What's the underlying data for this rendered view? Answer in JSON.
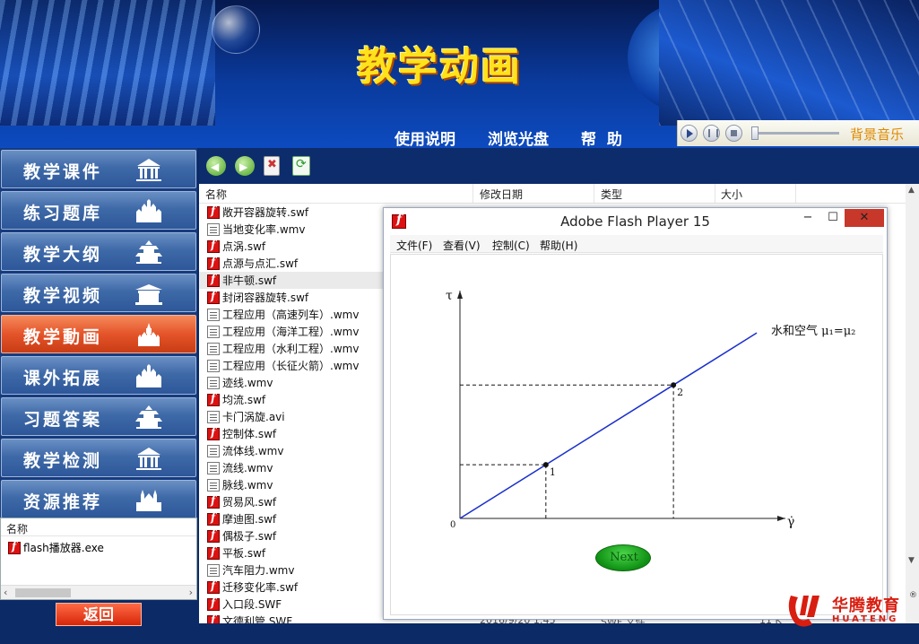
{
  "banner": {
    "title": "教学动画",
    "nav": [
      "使用说明",
      "浏览光盘",
      "帮  助"
    ]
  },
  "music": {
    "label": "背景音乐",
    "controls": [
      "play-icon",
      "pause-icon",
      "stop-icon"
    ]
  },
  "sidebar": {
    "items": [
      {
        "label": "教学课件",
        "icon": "building-icon"
      },
      {
        "label": "练习题库",
        "icon": "castle-icon"
      },
      {
        "label": "教学大纲",
        "icon": "temple-icon"
      },
      {
        "label": "教学视频",
        "icon": "gate-icon"
      },
      {
        "label": "教学動画",
        "icon": "kremlin-icon",
        "active": true
      },
      {
        "label": "课外拓展",
        "icon": "castle-icon"
      },
      {
        "label": "习题答案",
        "icon": "temple-icon"
      },
      {
        "label": "教学检测",
        "icon": "building-icon"
      },
      {
        "label": "资源推荐",
        "icon": "cathedral-icon"
      }
    ],
    "list_header": "名称",
    "list_items": [
      {
        "name": "flash播放器.exe",
        "type": "swf"
      }
    ],
    "back_label": "返回"
  },
  "explorer": {
    "columns": [
      "名称",
      "修改日期",
      "类型",
      "大小"
    ],
    "files": [
      {
        "name": "敞开容器旋转.swf",
        "type": "swf"
      },
      {
        "name": "当地变化率.wmv",
        "type": "vid"
      },
      {
        "name": "点涡.swf",
        "type": "swf"
      },
      {
        "name": "点源与点汇.swf",
        "type": "swf"
      },
      {
        "name": "非牛顿.swf",
        "type": "swf",
        "selected": true
      },
      {
        "name": "封闭容器旋转.swf",
        "type": "swf"
      },
      {
        "name": "工程应用（高速列车）.wmv",
        "type": "vid"
      },
      {
        "name": "工程应用（海洋工程）.wmv",
        "type": "vid"
      },
      {
        "name": "工程应用（水利工程）.wmv",
        "type": "vid"
      },
      {
        "name": "工程应用（长征火箭）.wmv",
        "type": "vid"
      },
      {
        "name": "迹线.wmv",
        "type": "vid"
      },
      {
        "name": "均流.swf",
        "type": "swf"
      },
      {
        "name": "卡门涡旋.avi",
        "type": "vid"
      },
      {
        "name": "控制体.swf",
        "type": "swf"
      },
      {
        "name": "流体线.wmv",
        "type": "vid"
      },
      {
        "name": "流线.wmv",
        "type": "vid"
      },
      {
        "name": "脉线.wmv",
        "type": "vid"
      },
      {
        "name": "贸易风.swf",
        "type": "swf"
      },
      {
        "name": "摩迪图.swf",
        "type": "swf"
      },
      {
        "name": "偶极子.swf",
        "type": "swf"
      },
      {
        "name": "平板.swf",
        "type": "swf"
      },
      {
        "name": "汽车阻力.wmv",
        "type": "vid"
      },
      {
        "name": "迁移变化率.swf",
        "type": "swf"
      },
      {
        "name": "入口段.SWF",
        "type": "swf"
      },
      {
        "name": "文德利管.SWF",
        "type": "swf"
      }
    ],
    "partial_row": {
      "date": "2016/9/20 1:45",
      "type": "SWF 文件",
      "size": "11 K"
    }
  },
  "flash": {
    "title": "Adobe Flash Player 15",
    "window_buttons": [
      "−",
      "☐",
      "✕"
    ],
    "menu": [
      "文件(F)",
      "查看(V)",
      "控制(C)",
      "帮助(H)"
    ],
    "next_label": "Next"
  },
  "chart_data": {
    "type": "line",
    "xlabel": "γ̇",
    "ylabel": "τ",
    "origin_label": "0",
    "series": [
      {
        "name": "水和空气 μ₁=μ₂",
        "x": [
          0,
          10
        ],
        "y": [
          0,
          10
        ]
      }
    ],
    "points": [
      {
        "label": "1",
        "x": 3.3,
        "y": 3.3
      },
      {
        "label": "2",
        "x": 8.2,
        "y": 8.2
      }
    ],
    "xlim": [
      0,
      12.5
    ],
    "ylim": [
      0,
      14
    ],
    "grid": false,
    "line_color": "#1a2fcc"
  },
  "logo": {
    "name": "华腾教育",
    "sub": "HUATENG",
    "reg": "®",
    "color": "#d81e10"
  }
}
